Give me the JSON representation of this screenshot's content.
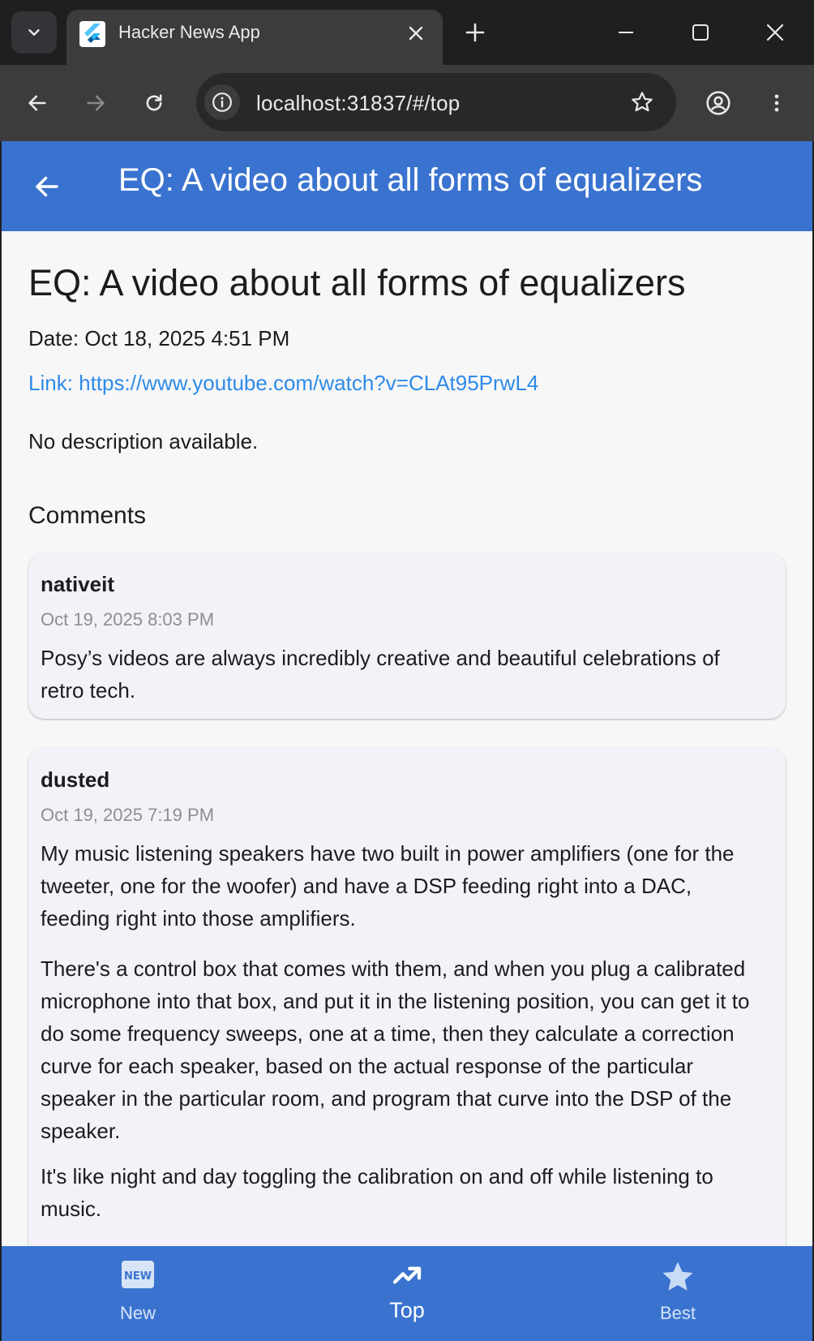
{
  "browser": {
    "tab": {
      "title": "Hacker News App",
      "favicon": "flutter-logo"
    },
    "address": {
      "url": "localhost:31837/#/top"
    },
    "icons": [
      "tab-search-icon",
      "close-icon",
      "plus-icon",
      "minimize-icon",
      "maximize-icon",
      "close-icon",
      "back-arrow-icon",
      "forward-arrow-icon",
      "reload-icon",
      "site-info-icon",
      "bookmark-star-icon",
      "profile-icon",
      "more-vert-icon"
    ]
  },
  "app": {
    "appbar": {
      "title": "EQ: A video about all forms of equalizers",
      "back_icon": "arrow-back-icon"
    },
    "story": {
      "title": "EQ: A video about all forms of equalizers",
      "date": "Date: Oct 18, 2025 4:51 PM",
      "link": "Link: https://www.youtube.com/watch?v=CLAt95PrwL4",
      "description": "No description available."
    },
    "comments_heading": "Comments",
    "comments": [
      {
        "author": "nativeit",
        "time": "Oct 19, 2025 8:03 PM",
        "paragraphs": [
          "Posy’s videos are always incredibly creative and beautiful celebrations of retro tech."
        ]
      },
      {
        "author": "dusted",
        "time": "Oct 19, 2025 7:19 PM",
        "paragraphs": [
          "My music listening speakers have two built in power amplifiers (one for the tweeter, one for the woofer) and have a DSP feeding right into a DAC, feeding right into those amplifiers.",
          "There's a control box that comes with them, and when you plug a calibrated microphone into that box, and put it in the listening position, you can get it to do some frequency sweeps, one at a time, then they calculate a correction curve for each speaker, based on the actual response of the particular speaker in the particular room, and program that curve into the DSP of the speaker.",
          "It's like night and day toggling the calibration on and off while listening to music."
        ]
      }
    ],
    "bottom_nav": {
      "items": [
        {
          "label": "New",
          "icon": "new-releases-icon"
        },
        {
          "label": "Top",
          "icon": "trending-up-icon",
          "selected": true
        },
        {
          "label": "Best",
          "icon": "star-icon"
        }
      ]
    },
    "colors": {
      "primary": "#3a73cf",
      "link": "#2d8ae8",
      "card": "#f4f2f8",
      "background": "#f7f7f7"
    }
  }
}
